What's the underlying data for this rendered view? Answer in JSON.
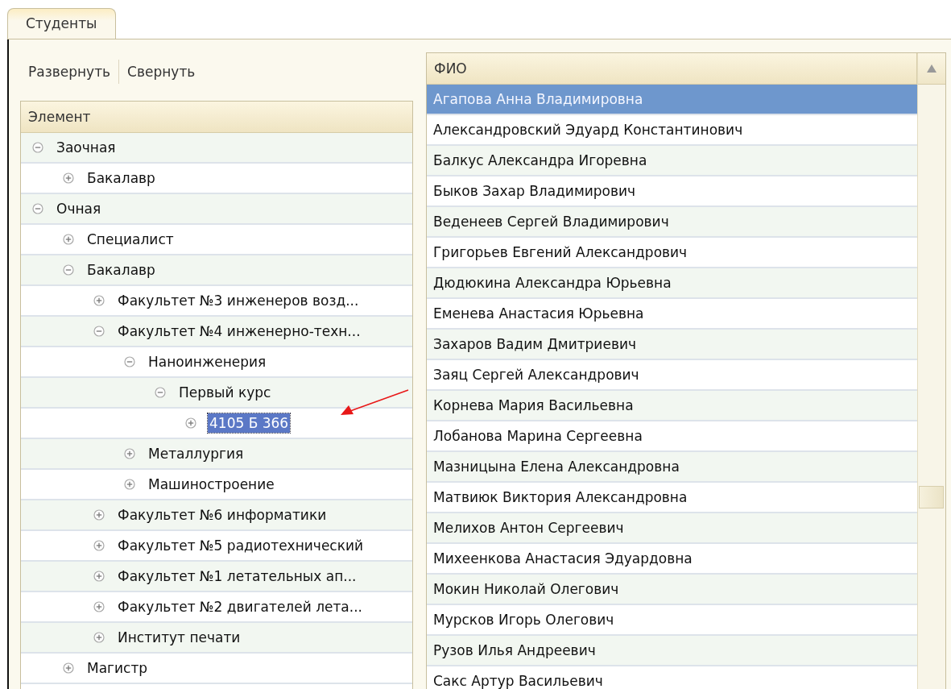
{
  "tabs": [
    {
      "label": "Студенты",
      "selected": true
    }
  ],
  "toolbar": [
    "Развернуть",
    "Свернуть"
  ],
  "tree": {
    "column": "Элемент",
    "items": [
      {
        "label": "Заочная",
        "expanded": true,
        "selected": false,
        "children": [
          {
            "label": "Бакалавр",
            "expanded": false,
            "selected": false
          }
        ]
      },
      {
        "label": "Очная",
        "expanded": true,
        "selected": false,
        "children": [
          {
            "label": "Специалист",
            "expanded": false,
            "selected": false
          },
          {
            "label": "Бакалавр",
            "expanded": true,
            "selected": false,
            "children": [
              {
                "label": "Факультет №3 инженеров возд...",
                "expanded": false,
                "selected": false
              },
              {
                "label": "Факультет №4 инженерно-техн...",
                "expanded": true,
                "selected": false,
                "children": [
                  {
                    "label": "Наноинженерия",
                    "expanded": true,
                    "selected": false,
                    "children": [
                      {
                        "label": "Первый курс",
                        "expanded": true,
                        "selected": false,
                        "children": [
                          {
                            "label": "4105 Б 366",
                            "expanded": false,
                            "selected": true
                          }
                        ]
                      }
                    ]
                  },
                  {
                    "label": "Металлургия",
                    "expanded": false,
                    "selected": false
                  },
                  {
                    "label": "Машиностроение",
                    "expanded": false,
                    "selected": false
                  }
                ]
              },
              {
                "label": "Факультет №6 информатики",
                "expanded": false,
                "selected": false
              },
              {
                "label": "Факультет №5 радиотехнический",
                "expanded": false,
                "selected": false
              },
              {
                "label": "Факультет №1 летательных ап...",
                "expanded": false,
                "selected": false
              },
              {
                "label": "Факультет №2 двигателей лета...",
                "expanded": false,
                "selected": false
              },
              {
                "label": "Институт печати",
                "expanded": false,
                "selected": false
              }
            ]
          },
          {
            "label": "Магистр",
            "expanded": false,
            "selected": false
          }
        ]
      }
    ]
  },
  "students": {
    "column": "ФИО",
    "rows": [
      {
        "name": "Агапова Анна Владимировна",
        "selected": true
      },
      {
        "name": "Александровский Эдуард Константинович",
        "selected": false
      },
      {
        "name": "Балкус Александра Игоревна",
        "selected": false
      },
      {
        "name": "Быков Захар Владимирович",
        "selected": false
      },
      {
        "name": "Веденеев Сергей Владимирович",
        "selected": false
      },
      {
        "name": "Григорьев Евгений Александрович",
        "selected": false
      },
      {
        "name": "Дюдюкина Александра Юрьевна",
        "selected": false
      },
      {
        "name": "Еменева Анастасия Юрьевна",
        "selected": false
      },
      {
        "name": "Захаров Вадим Дмитриевич",
        "selected": false
      },
      {
        "name": "Заяц Сергей Александрович",
        "selected": false
      },
      {
        "name": "Корнева Мария Васильевна",
        "selected": false
      },
      {
        "name": "Лобанова Марина Сергеевна",
        "selected": false
      },
      {
        "name": "Мазницына Елена Александровна",
        "selected": false
      },
      {
        "name": "Матвиюк Виктория Александровна",
        "selected": false
      },
      {
        "name": "Мелихов Антон Сергеевич",
        "selected": false
      },
      {
        "name": "Михеенкова Анастасия Эдуардовна",
        "selected": false
      },
      {
        "name": "Мокин Николай Олегович",
        "selected": false
      },
      {
        "name": "Мурсков Игорь Олегович",
        "selected": false
      },
      {
        "name": "Рузов Илья Андреевич",
        "selected": false
      },
      {
        "name": "Сакс Артур Васильевич",
        "selected": false
      }
    ]
  }
}
